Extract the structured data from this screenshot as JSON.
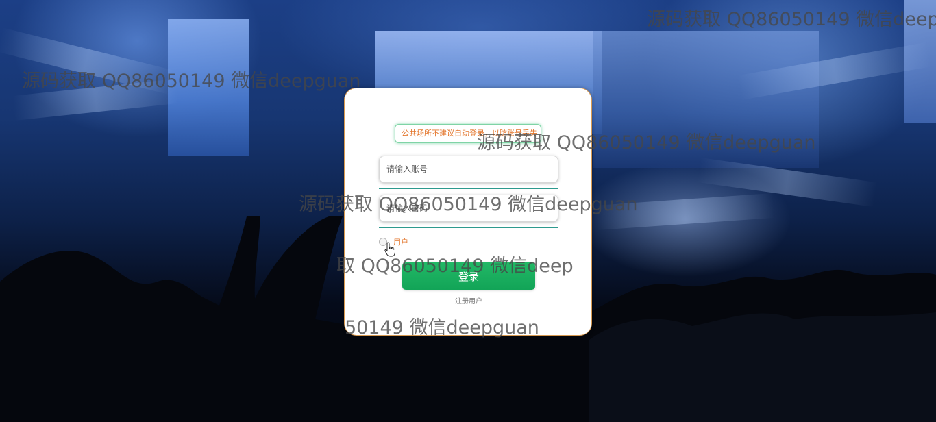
{
  "login": {
    "notice": "公共场所不建议自动登录，以防账号丢失",
    "username_placeholder": "请输入账号",
    "password_placeholder": "请输入密码",
    "role_label": "用户",
    "login_button": "登录",
    "register_link": "注册用户"
  },
  "watermark": {
    "text": "源码获取 QQ86050149 微信deepguan",
    "partial_1": "取 QQ86050149 微信deep",
    "partial_2": "50149 微信deepguan"
  },
  "colors": {
    "accent_green": "#16a85a",
    "notice_text": "#e3762c",
    "card_border": "#d99b52"
  }
}
